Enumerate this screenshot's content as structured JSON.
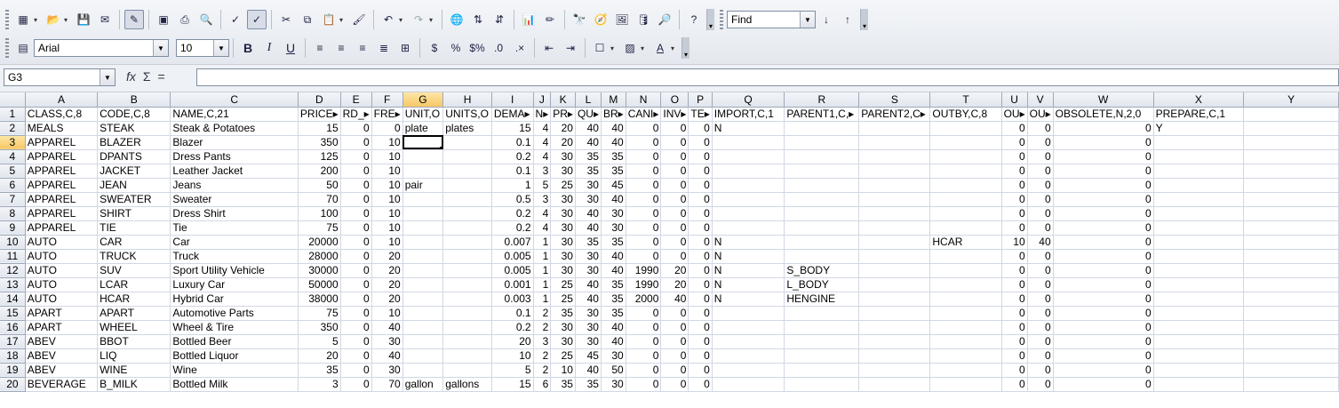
{
  "toolbar": {
    "font_name": "Arial",
    "font_size": "10",
    "find_placeholder": "Find"
  },
  "formula": {
    "cell_ref": "G3",
    "content": ""
  },
  "grid": {
    "col_letters": [
      "A",
      "B",
      "C",
      "D",
      "E",
      "F",
      "G",
      "H",
      "I",
      "J",
      "K",
      "L",
      "M",
      "N",
      "O",
      "P",
      "Q",
      "R",
      "S",
      "T",
      "U",
      "V",
      "W",
      "X",
      "Y"
    ],
    "header_row": [
      "CLASS,C,8",
      "CODE,C,8",
      "NAME,C,21",
      "PRICE▸",
      "RD_▸",
      "FRE▸",
      "UNIT,O",
      "UNITS,O",
      "DEMA▸",
      "N▸",
      "PR▸",
      "QU▸",
      "BR▸",
      "CANI▸",
      "INV▸",
      "TE▸",
      "IMPORT,C,1",
      "PARENT1,C,▸",
      "PARENT2,C▸",
      "OUTBY,C,8",
      "OU▸",
      "OU▸",
      "OBSOLETE,N,2,0",
      "PREPARE,C,1",
      ""
    ],
    "rows": [
      [
        "MEALS",
        "STEAK",
        "Steak & Potatoes",
        "15",
        "0",
        "0",
        "plate",
        "plates",
        "15",
        "4",
        "20",
        "40",
        "40",
        "0",
        "0",
        "0",
        "N",
        "",
        "",
        "",
        "0",
        "0",
        "0",
        "Y",
        ""
      ],
      [
        "APPAREL",
        "BLAZER",
        "Blazer",
        "350",
        "0",
        "10",
        "",
        "",
        "0.1",
        "4",
        "20",
        "40",
        "40",
        "0",
        "0",
        "0",
        "",
        "",
        "",
        "",
        "0",
        "0",
        "0",
        "",
        ""
      ],
      [
        "APPAREL",
        "DPANTS",
        "Dress Pants",
        "125",
        "0",
        "10",
        "",
        "",
        "0.2",
        "4",
        "30",
        "35",
        "35",
        "0",
        "0",
        "0",
        "",
        "",
        "",
        "",
        "0",
        "0",
        "0",
        "",
        ""
      ],
      [
        "APPAREL",
        "JACKET",
        "Leather Jacket",
        "200",
        "0",
        "10",
        "",
        "",
        "0.1",
        "3",
        "30",
        "35",
        "35",
        "0",
        "0",
        "0",
        "",
        "",
        "",
        "",
        "0",
        "0",
        "0",
        "",
        ""
      ],
      [
        "APPAREL",
        "JEAN",
        "Jeans",
        "50",
        "0",
        "10",
        "pair",
        "",
        "1",
        "5",
        "25",
        "30",
        "45",
        "0",
        "0",
        "0",
        "",
        "",
        "",
        "",
        "0",
        "0",
        "0",
        "",
        ""
      ],
      [
        "APPAREL",
        "SWEATER",
        "Sweater",
        "70",
        "0",
        "10",
        "",
        "",
        "0.5",
        "3",
        "30",
        "30",
        "40",
        "0",
        "0",
        "0",
        "",
        "",
        "",
        "",
        "0",
        "0",
        "0",
        "",
        ""
      ],
      [
        "APPAREL",
        "SHIRT",
        "Dress Shirt",
        "100",
        "0",
        "10",
        "",
        "",
        "0.2",
        "4",
        "30",
        "40",
        "30",
        "0",
        "0",
        "0",
        "",
        "",
        "",
        "",
        "0",
        "0",
        "0",
        "",
        ""
      ],
      [
        "APPAREL",
        "TIE",
        "Tie",
        "75",
        "0",
        "10",
        "",
        "",
        "0.2",
        "4",
        "30",
        "40",
        "30",
        "0",
        "0",
        "0",
        "",
        "",
        "",
        "",
        "0",
        "0",
        "0",
        "",
        ""
      ],
      [
        "AUTO",
        "CAR",
        "Car",
        "20000",
        "0",
        "10",
        "",
        "",
        "0.007",
        "1",
        "30",
        "35",
        "35",
        "0",
        "0",
        "0",
        "N",
        "",
        "",
        "HCAR",
        "10",
        "40",
        "0",
        "",
        ""
      ],
      [
        "AUTO",
        "TRUCK",
        "Truck",
        "28000",
        "0",
        "20",
        "",
        "",
        "0.005",
        "1",
        "30",
        "30",
        "40",
        "0",
        "0",
        "0",
        "N",
        "",
        "",
        "",
        "0",
        "0",
        "0",
        "",
        ""
      ],
      [
        "AUTO",
        "SUV",
        "Sport Utility Vehicle",
        "30000",
        "0",
        "20",
        "",
        "",
        "0.005",
        "1",
        "30",
        "30",
        "40",
        "1990",
        "20",
        "0",
        "N",
        "S_BODY",
        "",
        "",
        "0",
        "0",
        "0",
        "",
        ""
      ],
      [
        "AUTO",
        "LCAR",
        "Luxury Car",
        "50000",
        "0",
        "20",
        "",
        "",
        "0.001",
        "1",
        "25",
        "40",
        "35",
        "1990",
        "20",
        "0",
        "N",
        "L_BODY",
        "",
        "",
        "0",
        "0",
        "0",
        "",
        ""
      ],
      [
        "AUTO",
        "HCAR",
        "Hybrid Car",
        "38000",
        "0",
        "20",
        "",
        "",
        "0.003",
        "1",
        "25",
        "40",
        "35",
        "2000",
        "40",
        "0",
        "N",
        "HENGINE",
        "",
        "",
        "0",
        "0",
        "0",
        "",
        ""
      ],
      [
        "APART",
        "APART",
        "Automotive Parts",
        "75",
        "0",
        "10",
        "",
        "",
        "0.1",
        "2",
        "35",
        "30",
        "35",
        "0",
        "0",
        "0",
        "",
        "",
        "",
        "",
        "0",
        "0",
        "0",
        "",
        ""
      ],
      [
        "APART",
        "WHEEL",
        "Wheel & Tire",
        "350",
        "0",
        "40",
        "",
        "",
        "0.2",
        "2",
        "30",
        "30",
        "40",
        "0",
        "0",
        "0",
        "",
        "",
        "",
        "",
        "0",
        "0",
        "0",
        "",
        ""
      ],
      [
        "ABEV",
        "BBOT",
        "Bottled Beer",
        "5",
        "0",
        "30",
        "",
        "",
        "20",
        "3",
        "30",
        "30",
        "40",
        "0",
        "0",
        "0",
        "",
        "",
        "",
        "",
        "0",
        "0",
        "0",
        "",
        ""
      ],
      [
        "ABEV",
        "LIQ",
        "Bottled Liquor",
        "20",
        "0",
        "40",
        "",
        "",
        "10",
        "2",
        "25",
        "45",
        "30",
        "0",
        "0",
        "0",
        "",
        "",
        "",
        "",
        "0",
        "0",
        "0",
        "",
        ""
      ],
      [
        "ABEV",
        "WINE",
        "Wine",
        "35",
        "0",
        "30",
        "",
        "",
        "5",
        "2",
        "10",
        "40",
        "50",
        "0",
        "0",
        "0",
        "",
        "",
        "",
        "",
        "0",
        "0",
        "0",
        "",
        ""
      ],
      [
        "BEVERAGE",
        "B_MILK",
        "Bottled Milk",
        "3",
        "0",
        "70",
        "gallon",
        "gallons",
        "15",
        "6",
        "35",
        "35",
        "30",
        "0",
        "0",
        "0",
        "",
        "",
        "",
        "",
        "0",
        "0",
        "0",
        "",
        ""
      ]
    ]
  }
}
